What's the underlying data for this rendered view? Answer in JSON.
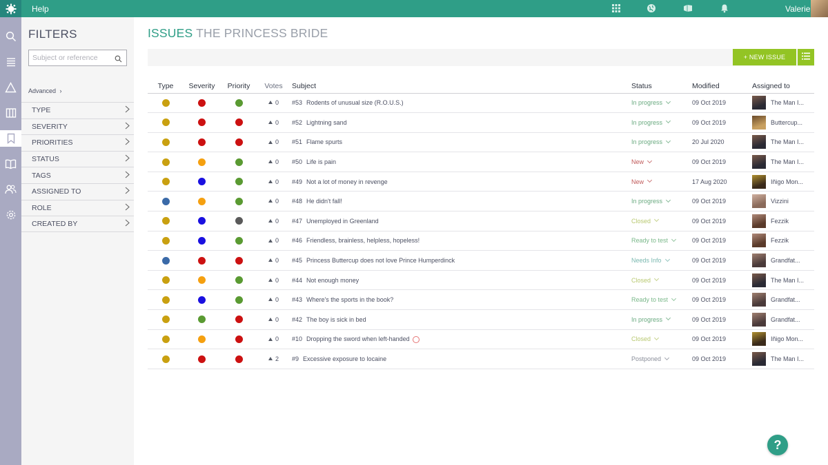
{
  "topbar": {
    "help_label": "Help",
    "user_name": "Valerie",
    "icons": [
      "logo-icon",
      "grid-icon",
      "globe-icon",
      "projects-icon",
      "bell-icon"
    ]
  },
  "sidebar": {
    "icons": [
      "search-icon",
      "backlog-icon",
      "epics-icon",
      "kanban-icon",
      "issues-icon",
      "wiki-icon",
      "team-icon",
      "settings-icon"
    ],
    "active": "issues-icon"
  },
  "filters": {
    "title": "FILTERS",
    "search_placeholder": "Subject or reference",
    "advanced_label": "Advanced",
    "items": [
      "TYPE",
      "SEVERITY",
      "PRIORITIES",
      "STATUS",
      "TAGS",
      "ASSIGNED TO",
      "ROLE",
      "CREATED BY"
    ]
  },
  "page": {
    "title_section": "ISSUES",
    "title_project": "THE PRINCESS BRIDE",
    "new_issue_label": "+ NEW ISSUE"
  },
  "table": {
    "headers": {
      "type": "Type",
      "severity": "Severity",
      "priority": "Priority",
      "votes": "Votes",
      "subject": "Subject",
      "status": "Status",
      "modified": "Modified",
      "assigned": "Assigned to"
    },
    "rows": [
      {
        "type": "#c9a010",
        "severity": "#cc1111",
        "priority": "#5a9a32",
        "votes": "0",
        "ref": "#53",
        "subject": "Rodents of unusual size (R.O.U.S.)",
        "status": "In progress",
        "status_color": "#6aaa80",
        "modified": "09 Oct 2019",
        "assigned": "The Man I...",
        "avatar": [
          "#2a2a34",
          "#7a5a4a"
        ]
      },
      {
        "type": "#c9a010",
        "severity": "#cc1111",
        "priority": "#cc1111",
        "votes": "0",
        "ref": "#52",
        "subject": "Lightning sand",
        "status": "In progress",
        "status_color": "#6aaa80",
        "modified": "09 Oct 2019",
        "assigned": "Buttercup...",
        "avatar": [
          "#c8a060",
          "#6a4a2a"
        ]
      },
      {
        "type": "#c9a010",
        "severity": "#cc1111",
        "priority": "#cc1111",
        "votes": "0",
        "ref": "#51",
        "subject": "Flame spurts",
        "status": "In progress",
        "status_color": "#6aaa80",
        "modified": "20 Jul 2020",
        "assigned": "The Man I...",
        "avatar": [
          "#2a2a34",
          "#7a5a4a"
        ]
      },
      {
        "type": "#c9a010",
        "severity": "#f5a010",
        "priority": "#5a9a32",
        "votes": "0",
        "ref": "#50",
        "subject": "Life is pain",
        "status": "New",
        "status_color": "#c05a5a",
        "modified": "09 Oct 2019",
        "assigned": "The Man I...",
        "avatar": [
          "#2a2a34",
          "#7a5a4a"
        ]
      },
      {
        "type": "#c9a010",
        "severity": "#1a10e0",
        "priority": "#5a9a32",
        "votes": "0",
        "ref": "#49",
        "subject": "Not a lot of money in revenge",
        "status": "New",
        "status_color": "#c05a5a",
        "modified": "17 Aug 2020",
        "assigned": "Iñigo Mon...",
        "avatar": [
          "#3a2a1a",
          "#b09030"
        ]
      },
      {
        "type": "#3a6aa8",
        "severity": "#f5a010",
        "priority": "#5a9a32",
        "votes": "0",
        "ref": "#48",
        "subject": "He didn't fall!",
        "status": "In progress",
        "status_color": "#6aaa80",
        "modified": "09 Oct 2019",
        "assigned": "Vizzini",
        "avatar": [
          "#8a6a5a",
          "#d0b0a0"
        ]
      },
      {
        "type": "#c9a010",
        "severity": "#1a10e0",
        "priority": "#5a5a5a",
        "votes": "0",
        "ref": "#47",
        "subject": "Unemployed in Greenland",
        "status": "Closed",
        "status_color": "#b8c870",
        "modified": "09 Oct 2019",
        "assigned": "Fezzik",
        "avatar": [
          "#5a3a2a",
          "#b08a7a"
        ]
      },
      {
        "type": "#c9a010",
        "severity": "#1a10e0",
        "priority": "#5a9a32",
        "votes": "0",
        "ref": "#46",
        "subject": "Friendless, brainless, helpless, hopeless!",
        "status": "Ready to test",
        "status_color": "#7ab88a",
        "modified": "09 Oct 2019",
        "assigned": "Fezzik",
        "avatar": [
          "#5a3a2a",
          "#b08a7a"
        ]
      },
      {
        "type": "#3a6aa8",
        "severity": "#cc1111",
        "priority": "#cc1111",
        "votes": "0",
        "ref": "#45",
        "subject": "Princess Buttercup does not love Prince Humperdinck",
        "status": "Needs Info",
        "status_color": "#7ab8b0",
        "modified": "09 Oct 2019",
        "assigned": "Grandfat...",
        "avatar": [
          "#4a3a3a",
          "#a08070"
        ]
      },
      {
        "type": "#c9a010",
        "severity": "#f5a010",
        "priority": "#5a9a32",
        "votes": "0",
        "ref": "#44",
        "subject": "Not enough money",
        "status": "Closed",
        "status_color": "#b8c870",
        "modified": "09 Oct 2019",
        "assigned": "The Man I...",
        "avatar": [
          "#2a2a34",
          "#7a5a4a"
        ]
      },
      {
        "type": "#c9a010",
        "severity": "#1a10e0",
        "priority": "#5a9a32",
        "votes": "0",
        "ref": "#43",
        "subject": "Where's the sports in the book?",
        "status": "Ready to test",
        "status_color": "#7ab88a",
        "modified": "09 Oct 2019",
        "assigned": "Grandfat...",
        "avatar": [
          "#4a3a3a",
          "#a08070"
        ]
      },
      {
        "type": "#c9a010",
        "severity": "#5a9a32",
        "priority": "#cc1111",
        "votes": "0",
        "ref": "#42",
        "subject": "The boy is sick in bed",
        "status": "In progress",
        "status_color": "#6aaa80",
        "modified": "09 Oct 2019",
        "assigned": "Grandfat...",
        "avatar": [
          "#4a3a3a",
          "#a08070"
        ]
      },
      {
        "type": "#c9a010",
        "severity": "#f5a010",
        "priority": "#cc1111",
        "votes": "0",
        "ref": "#10",
        "subject": "Dropping the sword when left-handed",
        "status": "Closed",
        "status_color": "#b8c870",
        "modified": "09 Oct 2019",
        "assigned": "Iñigo Mon...",
        "avatar": [
          "#3a2a1a",
          "#b09030"
        ],
        "due_icon": true
      },
      {
        "type": "#c9a010",
        "severity": "#cc1111",
        "priority": "#cc1111",
        "votes": "2",
        "ref": "#9",
        "subject": "Excessive exposure to locaine",
        "status": "Postponed",
        "status_color": "#8a8e9a",
        "modified": "09 Oct 2019",
        "assigned": "The Man I...",
        "avatar": [
          "#2a2a34",
          "#7a5a4a"
        ]
      }
    ]
  },
  "help_button": "?"
}
